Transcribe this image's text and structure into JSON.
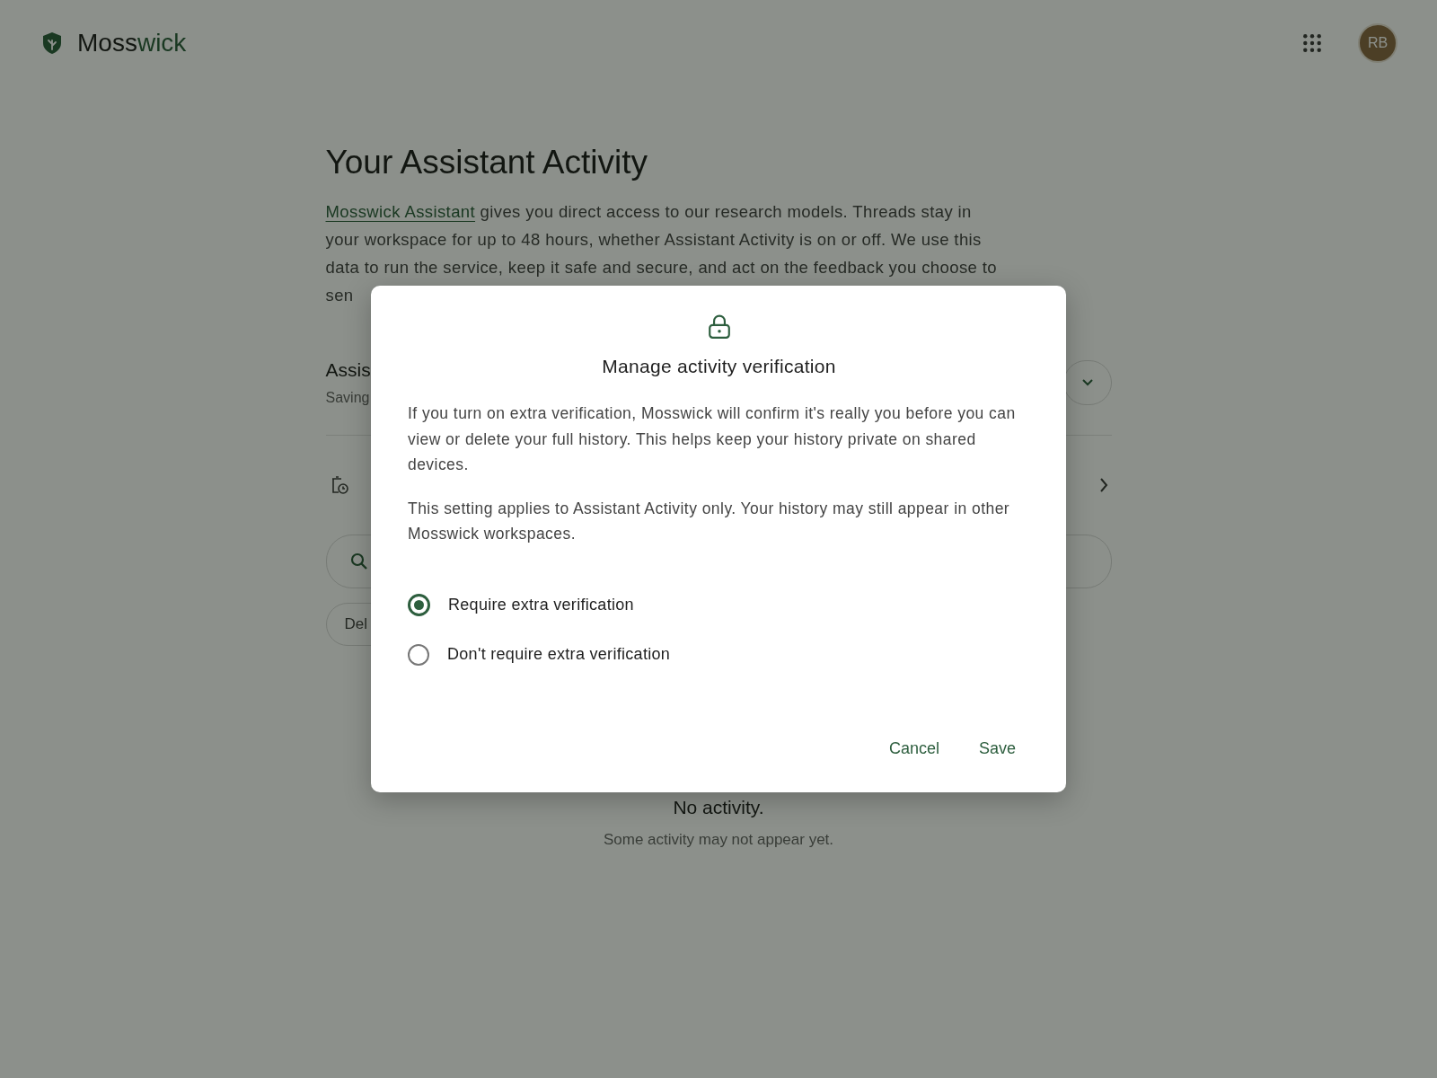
{
  "header": {
    "brand_start": "Moss",
    "brand_end": "wick",
    "avatar": "RB"
  },
  "page": {
    "title": "Your Assistant Activity",
    "intro_link": "Mosswick Assistant",
    "intro_text": " gives you direct access to our research models. Threads stay in your workspace for up to 48 hours, whether Assistant Activity is on or off. We use this data to run the service, keep it safe and secure, and act on the feedback you choose to sen",
    "setting": {
      "label": "Assis",
      "status": "Saving"
    },
    "delete_chip": "Del",
    "empty": {
      "title": "No activity.",
      "subtitle": "Some activity may not appear yet."
    }
  },
  "dialog": {
    "title": "Manage activity verification",
    "paragraphs": [
      "If you turn on extra verification, Mosswick will confirm it's really you before you can view or delete your full history. This helps keep your history private on shared devices.",
      "This setting applies to Assistant Activity only. Your history may still appear in other Mosswick workspaces."
    ],
    "options": [
      {
        "label": "Require extra verification",
        "selected": true
      },
      {
        "label": "Don't require extra verification",
        "selected": false
      }
    ],
    "buttons": [
      "Cancel",
      "Save"
    ]
  }
}
